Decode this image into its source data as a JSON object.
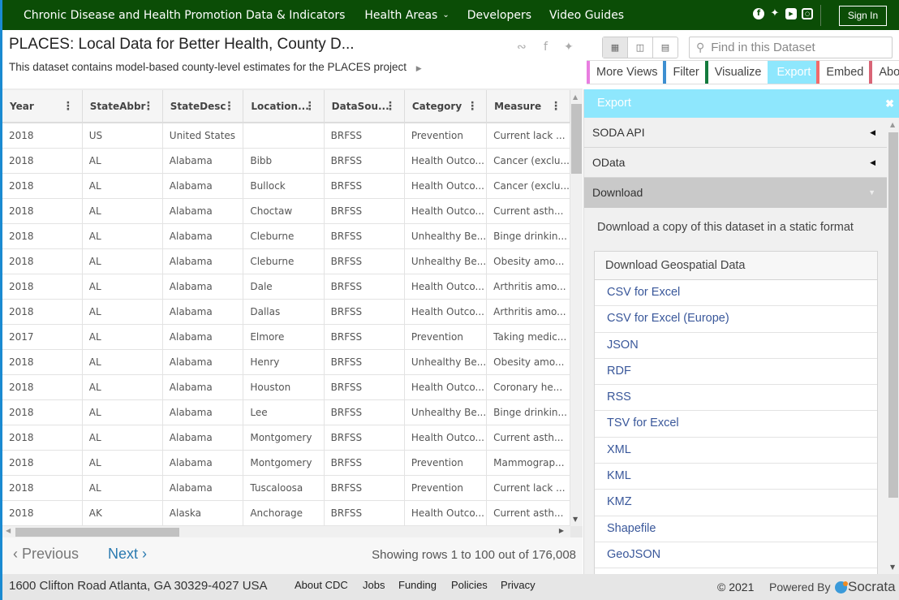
{
  "nav": {
    "brand": "Chronic Disease and Health Promotion Data & Indicators",
    "links": [
      "Health Areas",
      "Developers",
      "Video Guides"
    ],
    "social": [
      "facebook",
      "twitter",
      "youtube",
      "instagram"
    ],
    "signin": "Sign In"
  },
  "dataset": {
    "title": "PLACES: Local Data for Better Health, County D...",
    "description": "This dataset contains model-based county-level estimates for the PLACES project"
  },
  "search": {
    "placeholder": "Find in this Dataset"
  },
  "tabs": [
    {
      "label": "More Views",
      "color": "#e87ee0"
    },
    {
      "label": "Filter",
      "color": "#3d8fd1"
    },
    {
      "label": "Visualize",
      "color": "#137a3d"
    },
    {
      "label": "Export",
      "color": "#8ee7fd",
      "active": true
    },
    {
      "label": "Embed",
      "color": "#f26b6b"
    },
    {
      "label": "About",
      "color": "#d96476"
    }
  ],
  "grid": {
    "columns": [
      "Year",
      "StateAbbr",
      "StateDesc",
      "Location...",
      "DataSou...",
      "Category",
      "Measure"
    ],
    "rows": [
      [
        "2018",
        "US",
        "United States",
        "",
        "BRFSS",
        "Prevention",
        "Current lack ..."
      ],
      [
        "2018",
        "AL",
        "Alabama",
        "Bibb",
        "BRFSS",
        "Health Outco...",
        "Cancer (exclu..."
      ],
      [
        "2018",
        "AL",
        "Alabama",
        "Bullock",
        "BRFSS",
        "Health Outco...",
        "Cancer (exclu..."
      ],
      [
        "2018",
        "AL",
        "Alabama",
        "Choctaw",
        "BRFSS",
        "Health Outco...",
        "Current asth..."
      ],
      [
        "2018",
        "AL",
        "Alabama",
        "Cleburne",
        "BRFSS",
        "Unhealthy Be...",
        "Binge drinkin..."
      ],
      [
        "2018",
        "AL",
        "Alabama",
        "Cleburne",
        "BRFSS",
        "Unhealthy Be...",
        "Obesity amo..."
      ],
      [
        "2018",
        "AL",
        "Alabama",
        "Dale",
        "BRFSS",
        "Health Outco...",
        "Arthritis amo..."
      ],
      [
        "2018",
        "AL",
        "Alabama",
        "Dallas",
        "BRFSS",
        "Health Outco...",
        "Arthritis amo..."
      ],
      [
        "2017",
        "AL",
        "Alabama",
        "Elmore",
        "BRFSS",
        "Prevention",
        "Taking medic..."
      ],
      [
        "2018",
        "AL",
        "Alabama",
        "Henry",
        "BRFSS",
        "Unhealthy Be...",
        "Obesity amo..."
      ],
      [
        "2018",
        "AL",
        "Alabama",
        "Houston",
        "BRFSS",
        "Health Outco...",
        "Coronary he..."
      ],
      [
        "2018",
        "AL",
        "Alabama",
        "Lee",
        "BRFSS",
        "Unhealthy Be...",
        "Binge drinkin..."
      ],
      [
        "2018",
        "AL",
        "Alabama",
        "Montgomery",
        "BRFSS",
        "Health Outco...",
        "Current asth..."
      ],
      [
        "2018",
        "AL",
        "Alabama",
        "Montgomery",
        "BRFSS",
        "Prevention",
        "Mammograp..."
      ],
      [
        "2018",
        "AL",
        "Alabama",
        "Tuscaloosa",
        "BRFSS",
        "Prevention",
        "Current lack ..."
      ],
      [
        "2018",
        "AK",
        "Alaska",
        "Anchorage",
        "BRFSS",
        "Health Outco...",
        "Current asth..."
      ]
    ]
  },
  "pager": {
    "previous": "Previous",
    "next": "Next",
    "showing": "Showing rows 1 to 100 out of 176,008"
  },
  "export_panel": {
    "title": "Export",
    "sections": [
      "SODA API",
      "OData",
      "Download"
    ],
    "download_description": "Download a copy of this dataset in a static format",
    "geo_header": "Download Geospatial Data",
    "formats": [
      "CSV for Excel",
      "CSV for Excel (Europe)",
      "JSON",
      "RDF",
      "RSS",
      "TSV for Excel",
      "XML",
      "KML",
      "KMZ",
      "Shapefile",
      "GeoJSON"
    ]
  },
  "footer": {
    "address": "1600 Clifton Road Atlanta, GA 30329-4027 USA",
    "links": [
      "About CDC",
      "Jobs",
      "Funding",
      "Policies",
      "Privacy"
    ],
    "copyright": "© 2021",
    "powered_by": "Powered By",
    "brand": "Socrata"
  }
}
